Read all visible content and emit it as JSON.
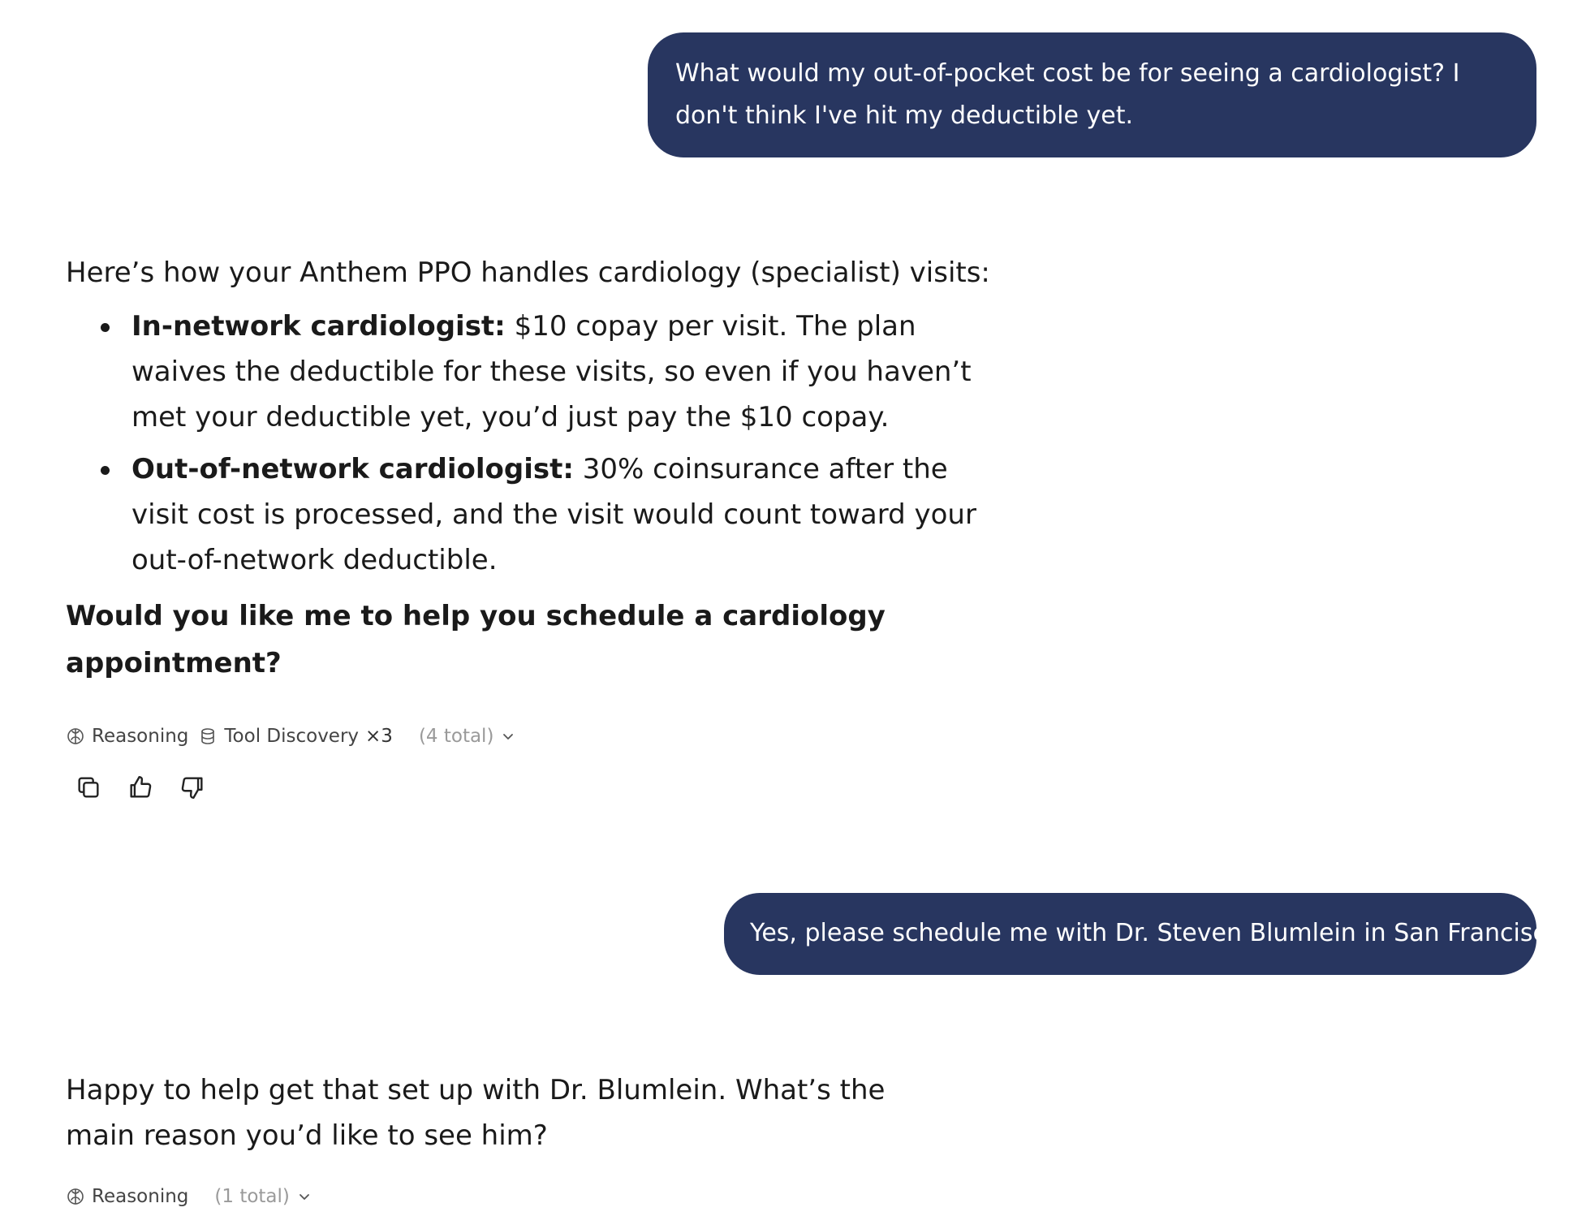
{
  "messages": {
    "user1": {
      "text": "What would my out-of-pocket cost be for seeing a cardiologist? I don't think I've hit my deductible yet."
    },
    "assistant1": {
      "intro": "Here’s how your Anthem PPO handles cardiology (specialist) visits:",
      "bullets": [
        {
          "label": "In-network cardiologist:",
          "text": " $10 copay per visit. The plan waives the deductible for these visits, so even if you haven’t met your deductible yet, you’d just pay the $10 copay."
        },
        {
          "label": "Out-of-network cardiologist:",
          "text": " 30% coinsurance after the visit cost is processed, and the visit would count toward your out-of-network deductible."
        }
      ],
      "question": "Would you like me to help you schedule a cardiology appointment?",
      "meta": {
        "reasoning_label": "Reasoning",
        "tool_label": "Tool Discovery",
        "tool_count": "×3",
        "total": "(4 total)"
      }
    },
    "user2": {
      "text": "Yes, please schedule me with Dr. Steven Blumlein in San Francisco"
    },
    "assistant2": {
      "text": "Happy to help get that set up with Dr. Blumlein. What’s the main reason you’d like to see him?",
      "meta": {
        "reasoning_label": "Reasoning",
        "total": "(1 total)"
      }
    }
  },
  "icons": {
    "reasoning": "brain-icon",
    "tool": "database-icon",
    "expand": "chevron-down-icon",
    "copy": "copy-icon",
    "like": "thumbs-up-icon",
    "dislike": "thumbs-down-icon"
  },
  "colors": {
    "user_bubble": "#283660",
    "user_text": "#ffffff",
    "body_text": "#1a1a1a",
    "muted_text": "#9a9a9a"
  }
}
